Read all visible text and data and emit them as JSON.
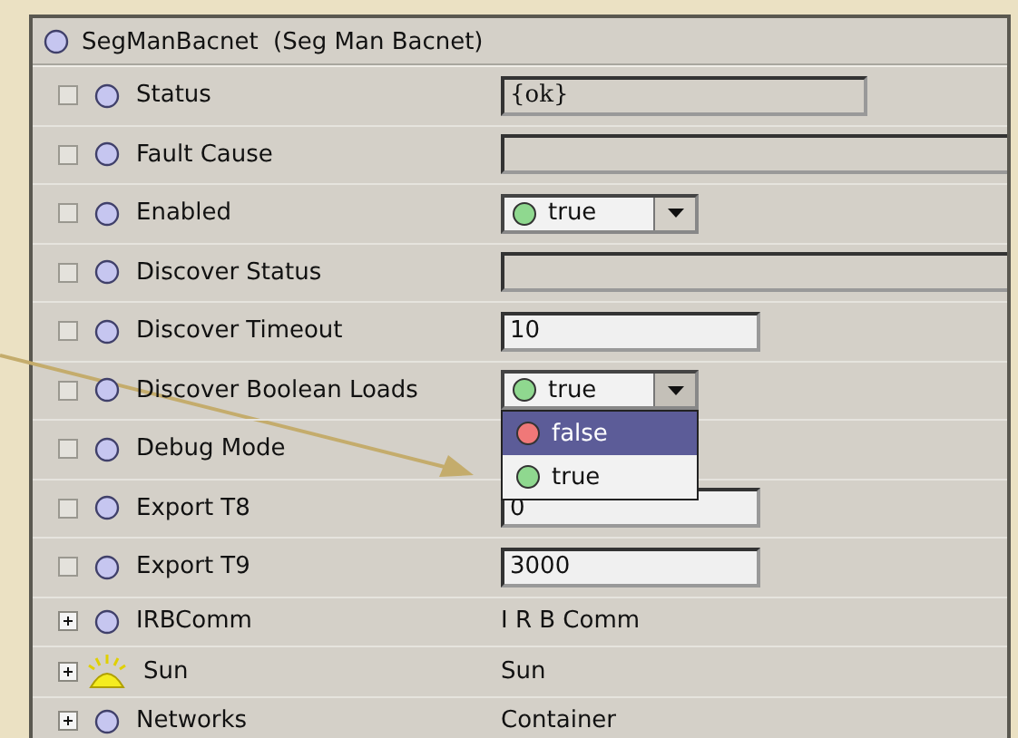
{
  "header": {
    "title": "SegManBacnet",
    "subtitle": "(Seg Man Bacnet)"
  },
  "rows": [
    {
      "label": "Status",
      "expandable": false,
      "icon": {
        "kind": "slot"
      },
      "kind": "status-field",
      "value": "{ok}"
    },
    {
      "label": "Fault Cause",
      "expandable": false,
      "icon": {
        "kind": "slot"
      },
      "kind": "wide-field"
    },
    {
      "label": "Enabled",
      "expandable": false,
      "icon": {
        "kind": "slot"
      },
      "kind": "dropdown",
      "value": "true",
      "color": "#8fd88f"
    },
    {
      "label": "Discover Status",
      "expandable": false,
      "icon": {
        "kind": "slot"
      },
      "kind": "wide-field"
    },
    {
      "label": "Discover Timeout",
      "expandable": false,
      "icon": {
        "kind": "slot"
      },
      "kind": "number-field",
      "value": "10"
    },
    {
      "label": "Discover Boolean Loads",
      "expandable": false,
      "icon": {
        "kind": "slot"
      },
      "kind": "dropdown",
      "value": "true",
      "color": "#8fd88f",
      "open": true,
      "options": [
        {
          "label": "false",
          "color": "#f07878",
          "highlighted": true
        },
        {
          "label": "true",
          "color": "#8fd88f",
          "highlighted": false
        }
      ]
    },
    {
      "label": "Debug Mode",
      "expandable": false,
      "icon": {
        "kind": "slot"
      }
    },
    {
      "label": "Export T8",
      "expandable": false,
      "icon": {
        "kind": "slot"
      },
      "kind": "number-field",
      "value": "0"
    },
    {
      "label": "Export T9",
      "expandable": false,
      "icon": {
        "kind": "slot"
      },
      "kind": "number-field",
      "value": "3000"
    },
    {
      "label": "IRBComm",
      "expandable": true,
      "icon": {
        "kind": "slot"
      },
      "kind": "text",
      "value": "I R B Comm"
    },
    {
      "label": "Sun",
      "expandable": true,
      "icon": {
        "kind": "sun"
      },
      "kind": "text",
      "value": "Sun"
    },
    {
      "label": "Networks",
      "expandable": true,
      "icon": {
        "kind": "slot"
      },
      "kind": "text",
      "value": "Container"
    }
  ]
}
